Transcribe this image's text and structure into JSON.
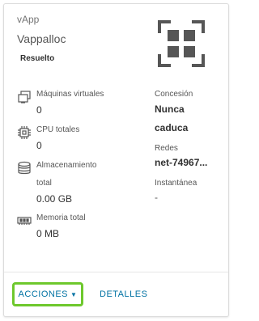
{
  "card": {
    "type_label": "vApp",
    "name": "Vappalloc",
    "status": "Resuelto",
    "icon": "vapp-grid-icon"
  },
  "stats": {
    "vms": {
      "label": "Máquinas virtuales",
      "value": "0",
      "icon": "vm-icon"
    },
    "cpu": {
      "label": "CPU totales",
      "value": "0",
      "icon": "cpu-icon"
    },
    "storage": {
      "label_line1": "Almacenamiento",
      "label_line2": "total",
      "value": "0.00 GB",
      "icon": "database-icon"
    },
    "memory": {
      "label": "Memoria total",
      "value": "0 MB",
      "icon": "memory-icon"
    }
  },
  "details": {
    "lease_label": "Concesión",
    "lease_value_line1": "Nunca",
    "lease_value_line2": "caduca",
    "networks_label": "Redes",
    "networks_value": "net-74967...",
    "snapshot_label": "Instantánea",
    "snapshot_value": "-"
  },
  "footer": {
    "actions_label": "ACCIONES",
    "actions_icon": "chevron-down-icon",
    "details_label": "DETALLES",
    "highlight_color": "#6ec82d",
    "link_color": "#0072a3"
  }
}
